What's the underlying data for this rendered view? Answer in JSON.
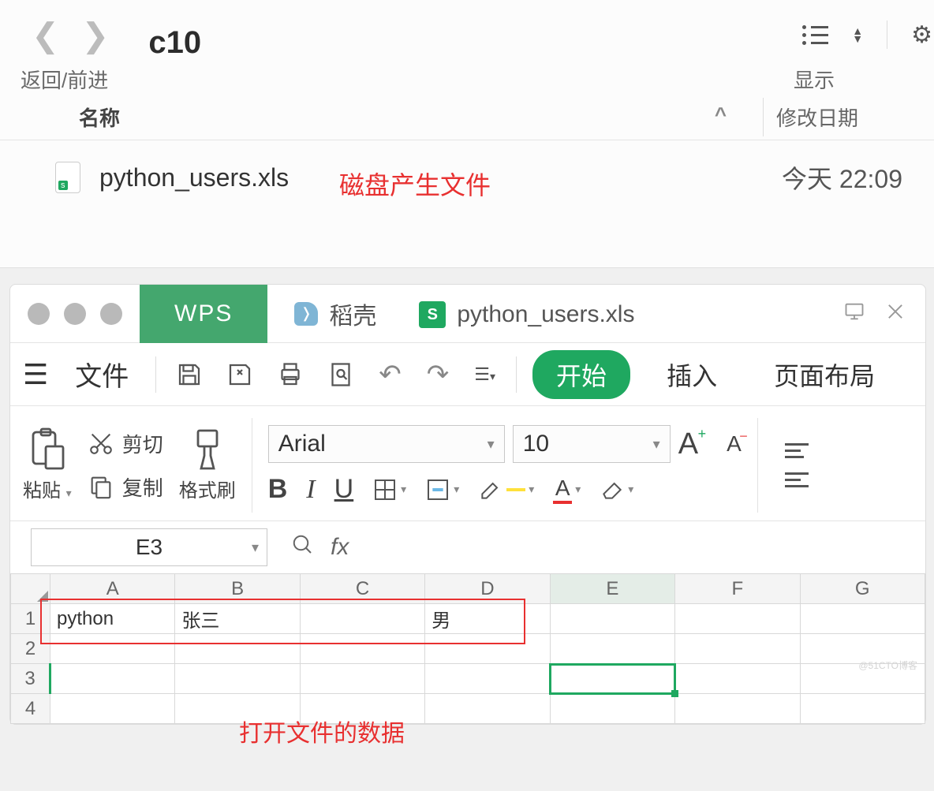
{
  "finder": {
    "title": "c10",
    "nav_label": "返回/前进",
    "view_label": "显示",
    "columns": {
      "name": "名称",
      "sort_caret": "^",
      "modified": "修改日期"
    },
    "row": {
      "filename": "python_users.xls",
      "date": "今天 22:09"
    },
    "annotation": "磁盘产生文件"
  },
  "wps": {
    "tabs": {
      "wps": "WPS",
      "dk": "稻壳",
      "file": "python_users.xls"
    },
    "menu": {
      "file": "文件",
      "start": "开始",
      "insert": "插入",
      "layout": "页面布局"
    },
    "ribbon": {
      "paste": "粘贴",
      "cut": "剪切",
      "copy": "复制",
      "format_brush": "格式刷",
      "font_name": "Arial",
      "font_size": "10"
    },
    "cellbar": {
      "ref": "E3",
      "fx": "fx"
    },
    "grid": {
      "cols": [
        "A",
        "B",
        "C",
        "D",
        "E",
        "F",
        "G"
      ],
      "rows": [
        "1",
        "2",
        "3",
        "4"
      ],
      "data": {
        "A1": "python",
        "B1": "张三",
        "D1": "男"
      }
    },
    "annotation": "打开文件的数据"
  },
  "watermark": "@51CTO博客"
}
